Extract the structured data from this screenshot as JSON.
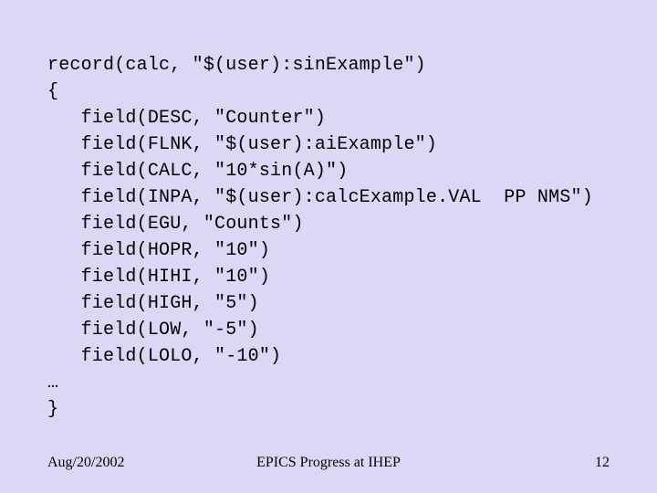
{
  "code": {
    "line1": "record(calc, \"$(user):sinExample\")",
    "line2": "{",
    "line3": "   field(DESC, \"Counter\")",
    "line4": "   field(FLNK, \"$(user):aiExample\")",
    "line5": "   field(CALC, \"10*sin(A)\")",
    "line6": "   field(INPA, \"$(user):calcExample.VAL  PP NMS\")",
    "line7": "   field(EGU, \"Counts\")",
    "line8": "   field(HOPR, \"10\")",
    "line9": "   field(HIHI, \"10\")",
    "line10": "   field(HIGH, \"5\")",
    "line11": "   field(LOW, \"-5\")",
    "line12": "   field(LOLO, \"-10\")",
    "line13": "…",
    "line14": "}"
  },
  "footer": {
    "date": "Aug/20/2002",
    "title": "EPICS Progress at IHEP",
    "page": "12"
  }
}
